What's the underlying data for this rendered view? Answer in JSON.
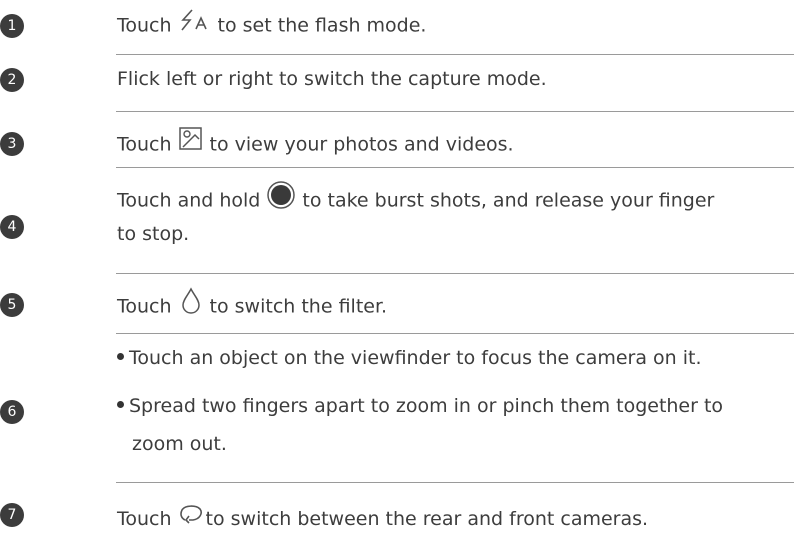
{
  "rows": [
    {
      "num": "1",
      "before": "Touch",
      "icon": "flash-auto-icon",
      "after": "to set the flash mode."
    },
    {
      "num": "2",
      "text": "Flick left or right to switch the capture mode."
    },
    {
      "num": "3",
      "before": "Touch",
      "icon": "gallery-icon",
      "after": "to view your photos and videos."
    },
    {
      "num": "4",
      "before": "Touch and hold",
      "icon": "shutter-icon",
      "after": "to take burst shots, and release your finger",
      "line2": "to stop."
    },
    {
      "num": "5",
      "before": "Touch",
      "icon": "filter-drop-icon",
      "after": "to switch the filter."
    },
    {
      "num": "6",
      "bullets": [
        {
          "line1": "Touch an object on the viewfinder to focus the camera on it."
        },
        {
          "line1": "Spread two fingers apart to zoom in or pinch them together to",
          "line2": "zoom out."
        }
      ]
    },
    {
      "num": "7",
      "before": "Touch",
      "icon": "switch-camera-icon",
      "after": "to switch between the rear and front cameras."
    }
  ]
}
